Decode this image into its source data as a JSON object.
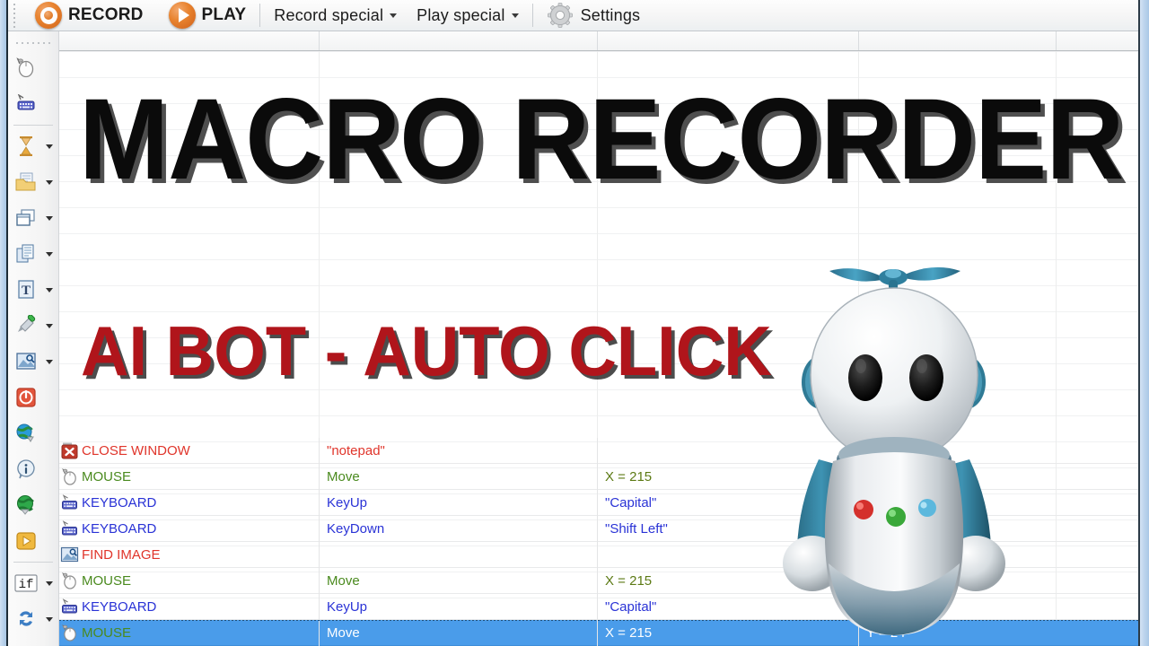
{
  "toolbar": {
    "record_label": "RECORD",
    "play_label": "PLAY",
    "record_special_label": "Record special",
    "play_special_label": "Play special",
    "settings_label": "Settings"
  },
  "left_toolbar": {
    "items": [
      {
        "name": "mouse-icon",
        "has_caret": false
      },
      {
        "name": "keyboard-icon",
        "has_caret": false
      },
      {
        "name": "wait-hourglass-icon",
        "has_caret": true
      },
      {
        "name": "folder-document-icon",
        "has_caret": true
      },
      {
        "name": "window-icon",
        "has_caret": true
      },
      {
        "name": "copy-icon",
        "has_caret": true
      },
      {
        "name": "text-icon",
        "has_caret": true
      },
      {
        "name": "color-picker-icon",
        "has_caret": true
      },
      {
        "name": "find-image-icon",
        "has_caret": true
      },
      {
        "name": "shutdown-icon",
        "has_caret": false
      },
      {
        "name": "globe-download-icon",
        "has_caret": false
      },
      {
        "name": "info-icon",
        "has_caret": false
      },
      {
        "name": "globe-upload-icon",
        "has_caret": false
      },
      {
        "name": "run-icon",
        "has_caret": false
      },
      {
        "name": "if-condition-icon",
        "label": "if",
        "has_caret": true
      },
      {
        "name": "loop-repeat-icon",
        "has_caret": true
      }
    ]
  },
  "overlay": {
    "title": "MACRO RECORDER",
    "subtitle": "AI BOT - AUTO CLICK",
    "title_color": "#0b0b0b",
    "subtitle_color": "#b0151b"
  },
  "grid": {
    "rows": [
      {
        "icon": "close-window-icon",
        "action": "CLOSE WINDOW",
        "action_color": "red",
        "detail": "\"notepad\"",
        "detail_color": "red",
        "x": "",
        "y": "",
        "selected": false
      },
      {
        "icon": "mouse-icon",
        "action": "MOUSE",
        "action_color": "green",
        "detail": "Move",
        "detail_color": "green",
        "x": "X = 215",
        "y": "",
        "selected": false
      },
      {
        "icon": "keyboard-icon",
        "action": "KEYBOARD",
        "action_color": "blue",
        "detail": "KeyUp",
        "detail_color": "blue",
        "x": "\"Capital\"",
        "y": "",
        "selected": false
      },
      {
        "icon": "keyboard-icon",
        "action": "KEYBOARD",
        "action_color": "blue",
        "detail": "KeyDown",
        "detail_color": "blue",
        "x": "\"Shift Left\"",
        "y": "",
        "selected": false
      },
      {
        "icon": "find-image-icon",
        "action": "FIND IMAGE",
        "action_color": "red",
        "detail": "",
        "detail_color": "red",
        "x": "",
        "y": "",
        "selected": false
      },
      {
        "icon": "mouse-icon",
        "action": "MOUSE",
        "action_color": "green",
        "detail": "Move",
        "detail_color": "green",
        "x": "X = 215",
        "y": "",
        "selected": false
      },
      {
        "icon": "keyboard-icon",
        "action": "KEYBOARD",
        "action_color": "blue",
        "detail": "KeyUp",
        "detail_color": "blue",
        "x": "\"Capital\"",
        "y": "",
        "selected": false
      },
      {
        "icon": "mouse-icon",
        "action": "MOUSE",
        "action_color": "green",
        "detail": "Move",
        "detail_color": "green",
        "x": "X = 215",
        "y": "Y = 24",
        "selected": true
      }
    ]
  },
  "colors": {
    "accent_orange": "#e8832f",
    "selection_blue": "#4a9cea",
    "red_text": "#e0352b",
    "green_text": "#4a8a1e",
    "blue_text": "#2a33d6"
  }
}
